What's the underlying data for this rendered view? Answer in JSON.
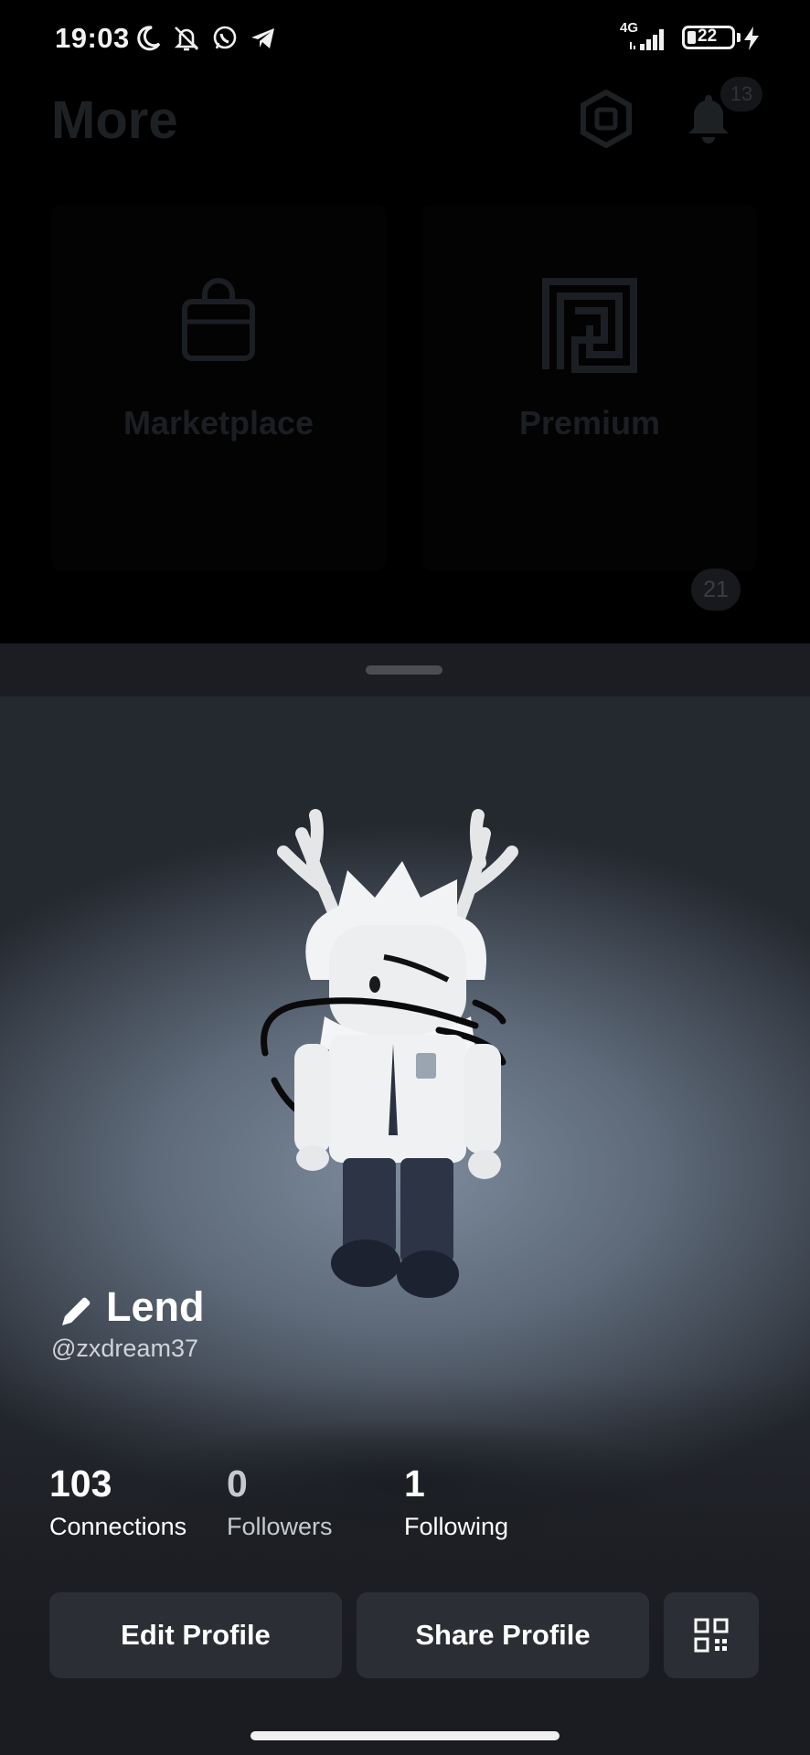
{
  "status_bar": {
    "time": "19:03",
    "network": "4G",
    "battery": "22"
  },
  "background_page": {
    "title": "More",
    "notification_count": "13",
    "tiles": [
      {
        "label": "Marketplace",
        "icon": "shopping-bag-icon"
      },
      {
        "label": "Premium",
        "icon": "premium-icon"
      }
    ],
    "tile_badge": "21"
  },
  "profile": {
    "display_name": "Lend",
    "username": "@zxdream37",
    "stats": [
      {
        "value": "103",
        "label": "Connections"
      },
      {
        "value": "0",
        "label": "Followers"
      },
      {
        "value": "1",
        "label": "Following"
      }
    ],
    "buttons": {
      "edit": "Edit Profile",
      "share": "Share Profile",
      "qr_icon": "qr-code-icon"
    }
  },
  "colors": {
    "sheet_bg": "#1b1c21",
    "button_bg": "#2c2e35",
    "text_primary": "#ffffff"
  }
}
